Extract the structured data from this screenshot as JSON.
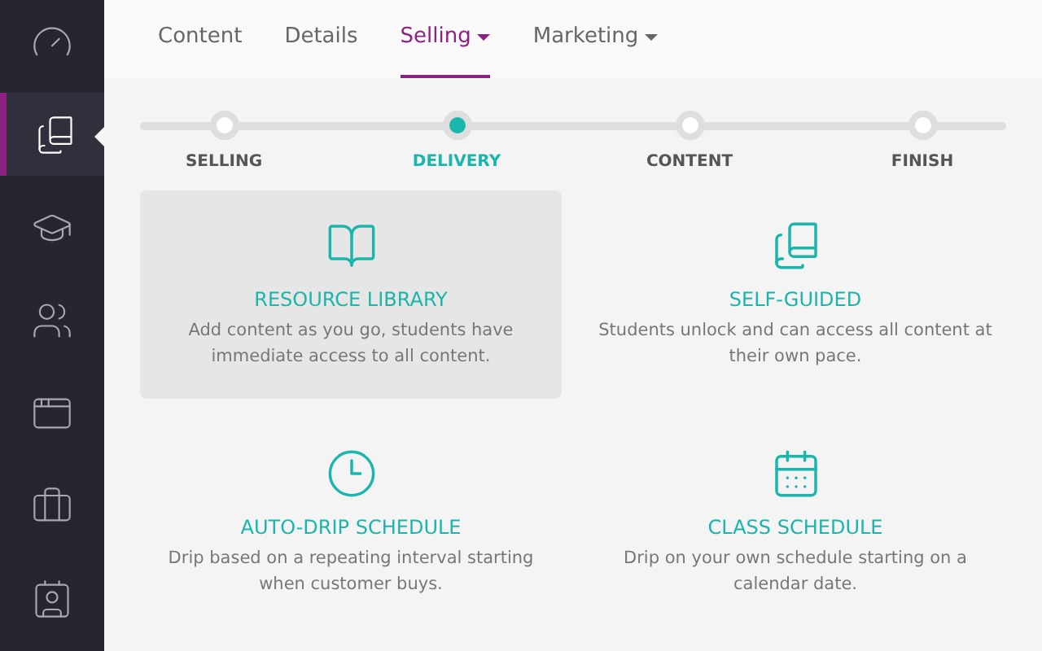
{
  "sidebar": {
    "items": [
      {
        "kind": "gauge",
        "selected": false
      },
      {
        "kind": "books",
        "selected": true
      },
      {
        "kind": "cap",
        "selected": false
      },
      {
        "kind": "users",
        "selected": false
      },
      {
        "kind": "window",
        "selected": false
      },
      {
        "kind": "briefcase",
        "selected": false
      },
      {
        "kind": "badge",
        "selected": false
      }
    ]
  },
  "tabs": [
    {
      "label": "Content",
      "selected": false,
      "dropdown": false
    },
    {
      "label": "Details",
      "selected": false,
      "dropdown": false
    },
    {
      "label": "Selling",
      "selected": true,
      "dropdown": true
    },
    {
      "label": "Marketing",
      "selected": false,
      "dropdown": true
    }
  ],
  "steps": [
    {
      "label": "SELLING",
      "selected": false
    },
    {
      "label": "DELIVERY",
      "selected": true
    },
    {
      "label": "CONTENT",
      "selected": false
    },
    {
      "label": "FINISH",
      "selected": false
    }
  ],
  "options": [
    {
      "kind": "book",
      "title": "RESOURCE LIBRARY",
      "text": "Add content as you go, students have immediate access to all content.",
      "selected": true
    },
    {
      "kind": "books",
      "title": "SELF-GUIDED",
      "text": "Students unlock and can access all content at their own pace.",
      "selected": false
    },
    {
      "kind": "clock",
      "title": "AUTO-DRIP SCHEDULE",
      "text": "Drip based on a repeating interval starting when customer buys.",
      "selected": false
    },
    {
      "kind": "calendar",
      "title": "CLASS SCHEDULE",
      "text": "Drip on your own schedule starting on a calendar date.",
      "selected": false
    }
  ]
}
